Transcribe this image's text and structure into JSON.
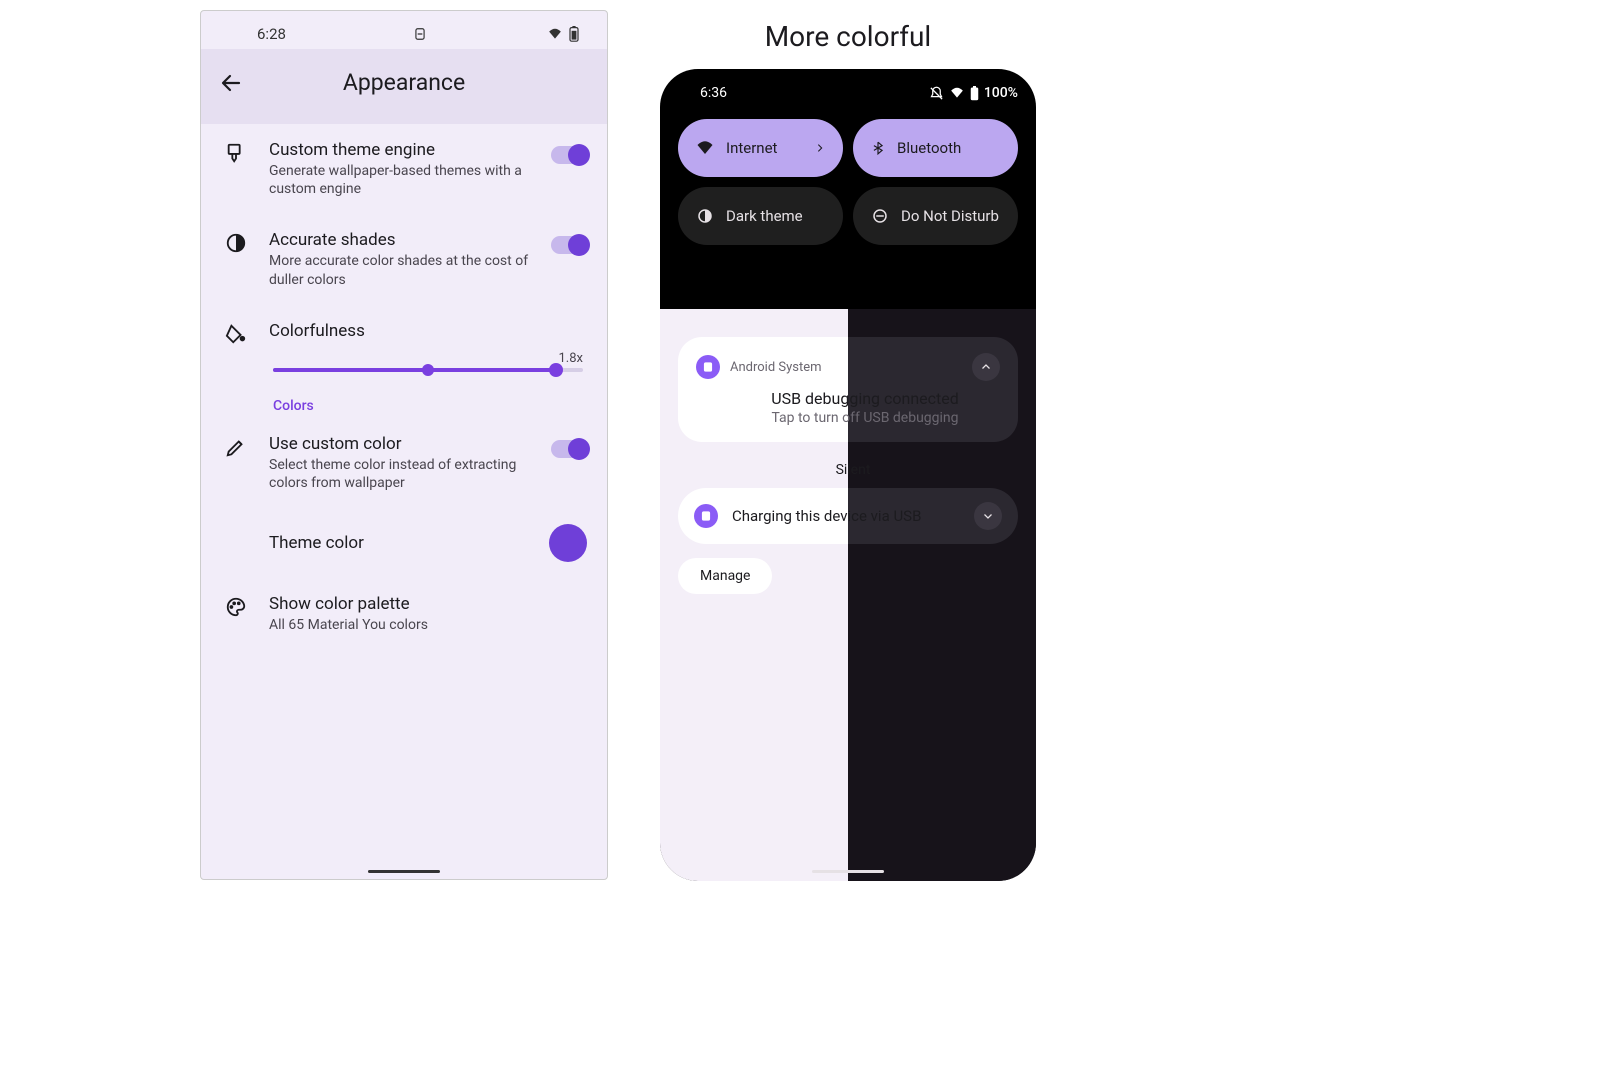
{
  "left": {
    "time": "6:28",
    "title": "Appearance",
    "items": {
      "custom_engine": {
        "title": "Custom theme engine",
        "sub": "Generate wallpaper-based themes with a custom engine"
      },
      "accurate": {
        "title": "Accurate shades",
        "sub": "More accurate color shades at the cost of duller colors"
      },
      "colorfulness": {
        "title": "Colorfulness"
      },
      "use_custom": {
        "title": "Use custom color",
        "sub": "Select theme color instead of extracting colors from wallpaper"
      },
      "theme_color": {
        "title": "Theme color"
      },
      "palette": {
        "title": "Show color palette",
        "sub": "All 65 Material You colors"
      }
    },
    "slider_value": "1.8x",
    "section_colors": "Colors",
    "theme_color_hex": "#6f3fd8"
  },
  "right": {
    "heading": "More colorful",
    "time": "6:36",
    "battery": "100%",
    "tiles": {
      "internet": "Internet",
      "bluetooth": "Bluetooth",
      "dark": "Dark theme",
      "dnd": "Do Not Disturb"
    },
    "notif1": {
      "app": "Android System",
      "title": "USB debugging connected",
      "sub": "Tap to turn off USB debugging"
    },
    "silent": "Silent",
    "notif2": {
      "title": "Charging this device via USB"
    },
    "manage": "Manage"
  }
}
